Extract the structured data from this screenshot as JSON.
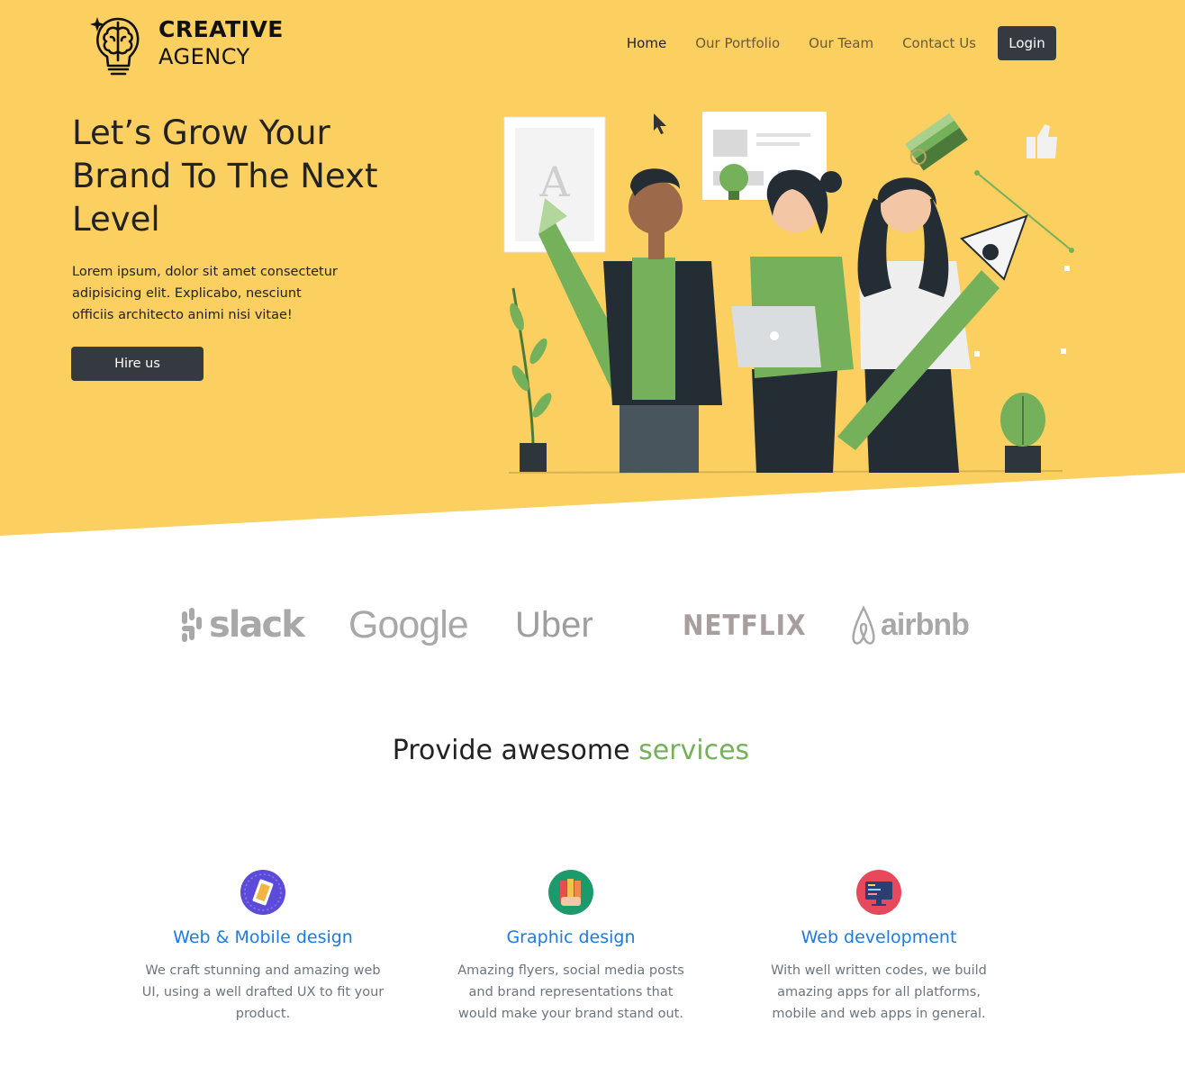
{
  "brand": {
    "line1": "CREATIVE",
    "line2": "AGENCY"
  },
  "nav": {
    "items": [
      "Home",
      "Our Portfolio",
      "Our Team",
      "Contact Us"
    ],
    "login_label": "Login"
  },
  "hero": {
    "title": "Let’s Grow Your Brand To The Next Level",
    "description": "Lorem ipsum, dolor sit amet consectetur adipisicing elit. Explicabo, nesciunt officiis architecto animi nisi vitae!",
    "cta_label": "Hire us"
  },
  "partners": [
    "slack",
    "Google",
    "Uber",
    "NETFLIX",
    "airbnb"
  ],
  "services": {
    "title_main": "Provide awesome ",
    "title_accent": "services",
    "items": [
      {
        "title": "Web & Mobile design",
        "description": "We craft stunning and amazing web UI, using a well drafted UX to fit your product.",
        "icon": "mobile-design-icon"
      },
      {
        "title": "Graphic design",
        "description": "Amazing flyers, social media posts and brand representations that would make your brand stand out.",
        "icon": "color-palette-icon"
      },
      {
        "title": "Web development",
        "description": "With well written codes, we build amazing apps for all platforms, mobile and web apps in general.",
        "icon": "code-monitor-icon"
      }
    ]
  },
  "colors": {
    "hero_bg": "#fbcf60",
    "dark_button": "#343a40",
    "accent_green": "#75b05a",
    "service_title_blue": "#1f7ae0"
  }
}
